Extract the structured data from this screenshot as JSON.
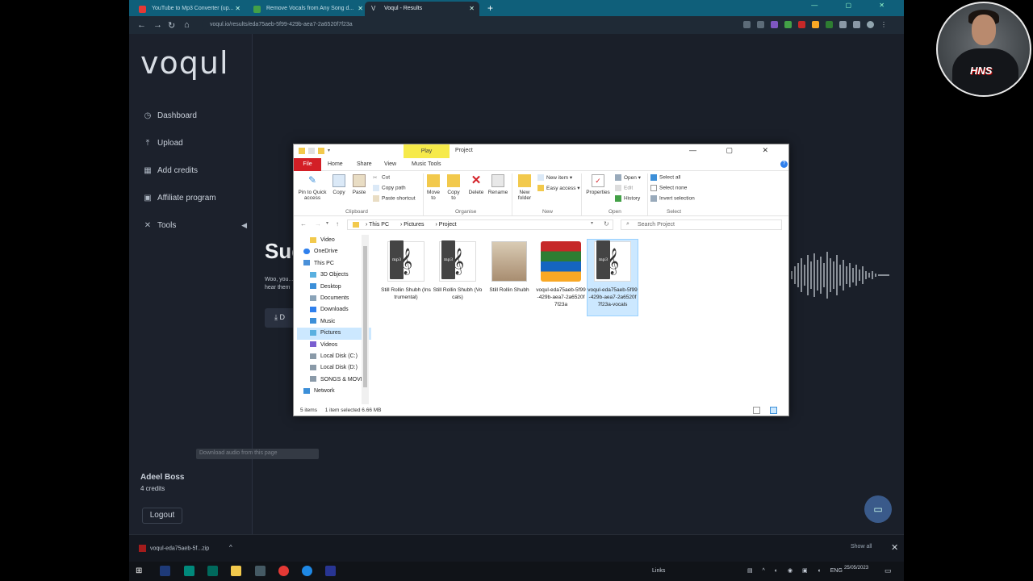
{
  "browser": {
    "tabs": [
      {
        "label": "YouTube to Mp3 Converter (up...",
        "color": "#e53935"
      },
      {
        "label": "Remove Vocals from Any Song d...",
        "color": "#43a047"
      },
      {
        "label": "Voqul - Results",
        "color": "#cfd8dc"
      }
    ],
    "url": "voqul.io/results/eda75aeb-5f99-429b-aea7-2a6520f7f23a"
  },
  "sidebar": {
    "logo": "voqul",
    "items": [
      {
        "label": "Dashboard",
        "icon": "dashboard-icon",
        "glyph": "◷"
      },
      {
        "label": "Upload",
        "icon": "upload-icon",
        "glyph": "⤒"
      },
      {
        "label": "Add credits",
        "icon": "credits-icon",
        "glyph": "▦"
      },
      {
        "label": "Affiliate program",
        "icon": "affiliate-icon",
        "glyph": "▣"
      },
      {
        "label": "Tools",
        "icon": "tools-icon",
        "glyph": "✕"
      }
    ],
    "user_name": "Adeel Boss",
    "credits": "4 credits",
    "logout": "Logout"
  },
  "main": {
    "heading": "Suc",
    "sub": "Woo, you... hear them",
    "download_label": "D"
  },
  "tooltip": "Download audio from this page",
  "explorer": {
    "title": "Project",
    "play_tab": "Play",
    "tabs": [
      "File",
      "Home",
      "Share",
      "View",
      "Music Tools"
    ],
    "ribbon": {
      "pin": "Pin to Quick access",
      "copy": "Copy",
      "paste": "Paste",
      "cut": "Cut",
      "copy_path": "Copy path",
      "paste_shortcut": "Paste shortcut",
      "move_to": "Move to",
      "copy_to": "Copy to",
      "delete": "Delete",
      "rename": "Rename",
      "new_folder": "New folder",
      "new_item": "New item",
      "easy_access": "Easy access",
      "properties": "Properties",
      "open": "Open",
      "edit": "Edit",
      "history": "History",
      "select_all": "Select all",
      "select_none": "Select none",
      "invert_selection": "Invert selection",
      "groups": [
        "Clipboard",
        "Organise",
        "New",
        "Open",
        "Select"
      ]
    },
    "breadcrumb": [
      "This PC",
      "Pictures",
      "Project"
    ],
    "search_placeholder": "Search Project",
    "nav": [
      {
        "label": "Video",
        "color": "#f2c94c"
      },
      {
        "label": "OneDrive",
        "color": "#2f80ed"
      },
      {
        "label": "This PC",
        "color": "#4a90d9"
      },
      {
        "label": "3D Objects",
        "color": "#5ab0e0"
      },
      {
        "label": "Desktop",
        "color": "#3c8fd8"
      },
      {
        "label": "Documents",
        "color": "#8aa3b8"
      },
      {
        "label": "Downloads",
        "color": "#2f80ed"
      },
      {
        "label": "Music",
        "color": "#3c8fd8"
      },
      {
        "label": "Pictures",
        "color": "#5ab0e0"
      },
      {
        "label": "Videos",
        "color": "#7a5fd0"
      },
      {
        "label": "Local Disk (C:)",
        "color": "#8a9aa8"
      },
      {
        "label": "Local Disk (D:)",
        "color": "#8a9aa8"
      },
      {
        "label": "SONGS & MOVII",
        "color": "#8a9aa8"
      },
      {
        "label": "Network",
        "color": "#3c8fd8"
      }
    ],
    "files": [
      {
        "name": "Still Rollin Shubh (Instrumental)",
        "kind": "mp3"
      },
      {
        "name": "Still Rollin Shubh (Vocals)",
        "kind": "mp3"
      },
      {
        "name": "Still Rollin Shubh",
        "kind": "image"
      },
      {
        "name": "voqul-eda75aeb-5f99-429b-aea7-2a6520f7f23a",
        "kind": "zip"
      },
      {
        "name": "voqul-eda75aeb-5f99-429b-aea7-2a6520f7f23a-vocals",
        "kind": "mp3"
      }
    ],
    "status_items": "5 items",
    "status_selected": "1 item selected  6.66 MB"
  },
  "downloads": {
    "file": "voqul-eda75aeb-5f...zip",
    "show_all": "Show all"
  },
  "taskbar": {
    "links": "Links",
    "lang": "ENG",
    "time": "",
    "date": "25/05/2023"
  },
  "webcam": {
    "badge": "HNS"
  }
}
